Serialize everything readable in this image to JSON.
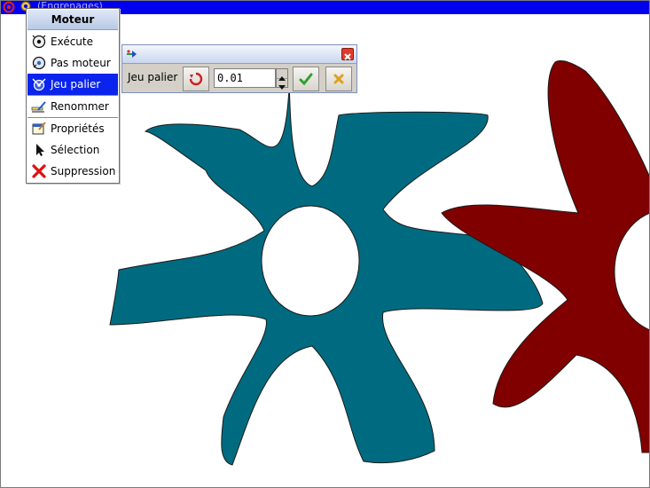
{
  "window": {
    "title": "(Engrenages)"
  },
  "context_menu": {
    "header": "Moteur",
    "items": [
      {
        "label": "Exécute",
        "icon": "run-motor-icon",
        "active": false
      },
      {
        "label": "Pas moteur",
        "icon": "motor-step-icon",
        "active": false
      },
      {
        "label": "Jeu palier",
        "icon": "bearing-play-icon",
        "active": true
      },
      {
        "label": "Renommer",
        "icon": "rename-icon",
        "active": false
      },
      {
        "label": "Propriétés",
        "icon": "properties-icon",
        "active": false
      },
      {
        "label": "Sélection",
        "icon": "cursor-arrow-icon",
        "active": false
      },
      {
        "label": "Suppression",
        "icon": "delete-x-icon",
        "active": false
      }
    ]
  },
  "dialog": {
    "label": "Jeu palier",
    "value": "0.01",
    "buttons": [
      "refresh-icon",
      "validate-check-icon",
      "cancel-x-icon"
    ]
  },
  "gears": {
    "left_color": "#006b80",
    "right_color": "#800000"
  }
}
